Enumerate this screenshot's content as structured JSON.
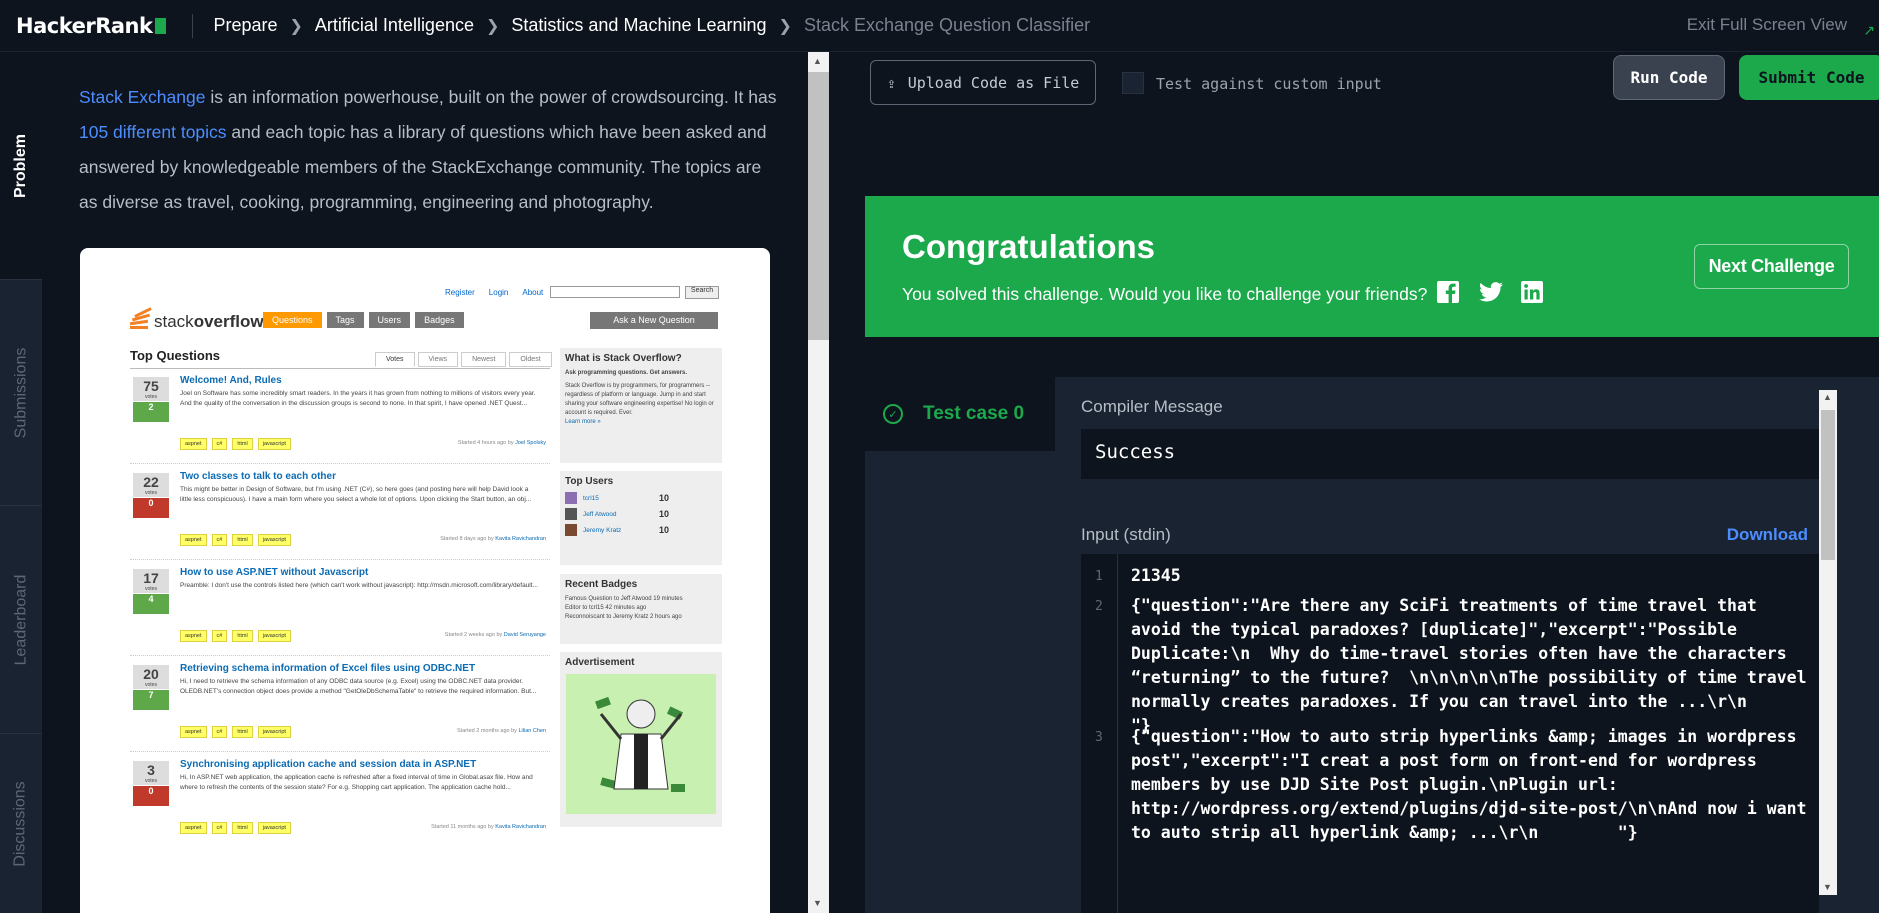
{
  "header": {
    "logo": "HackerRank",
    "breadcrumbs": [
      "Prepare",
      "Artificial Intelligence",
      "Statistics and Machine Learning"
    ],
    "current": "Stack Exchange Question Classifier",
    "exit_fullscreen": "Exit Full Screen View"
  },
  "vtabs": [
    "Problem",
    "Submissions",
    "Leaderboard",
    "Discussions"
  ],
  "problem": {
    "link1": "Stack Exchange",
    "text1": " is an information powerhouse, built on the power of crowdsourcing. It has ",
    "link2": "105 different topics",
    "text2": " and each topic has a library of questions which have been asked and answered by knowledgeable members of the StackExchange community. The topics are as diverse as travel, cooking, programming, engineering and photography."
  },
  "so_image": {
    "links": [
      "Register",
      "Login",
      "About"
    ],
    "search_btn": "Search",
    "logo_a": "stack",
    "logo_b": "overflow",
    "nav": [
      "Questions",
      "Tags",
      "Users",
      "Badges"
    ],
    "ask": "Ask a New Question",
    "title": "Top Questions",
    "tabs": [
      "Votes",
      "Views",
      "Newest",
      "Oldest"
    ],
    "questions": [
      {
        "votes": "75",
        "answers": "2",
        "status": "g",
        "title": "Welcome! And, Rules",
        "excerpt": "Joel on Software has some incredibly smart readers. In the years it has grown from nothing to millions of visitors every year. And the quality of the conversation in the discussion groups is second to none. In that spirit, I have opened .NET Quest...",
        "meta": "Started 4 hours ago by",
        "user": "Joel Spolsky"
      },
      {
        "votes": "22",
        "answers": "0",
        "status": "r",
        "title": "Two classes to talk to each other",
        "excerpt": "This might be better in Design of Software, but I'm using .NET (C#), so here goes (and posting here will help David look a little less conspicuous). I have a main form where you select a whole lot of options. Upon clicking the Start button, an obj...",
        "meta": "Started 8 days ago by",
        "user": "Kavita Ravichandran"
      },
      {
        "votes": "17",
        "answers": "4",
        "status": "g",
        "title": "How to use ASP.NET without Javascript",
        "excerpt": "Preamble: I don't use the controls listed here (which can't work without javascript): http://msdn.microsoft.com/library/default...",
        "meta": "Started 2 weeks ago by",
        "user": "David Seruyange"
      },
      {
        "votes": "20",
        "answers": "7",
        "status": "g",
        "title": "Retrieving schema information of Excel files using ODBC.NET",
        "excerpt": "Hi, I need to retrieve the schema information of any ODBC data source (e.g. Excel) using the ODBC.NET data provider. OLEDB.NET's connection object does provide a method \"GetOleDbSchemaTable\" to retrieve the required information. But...",
        "meta": "Started 2 months ago by",
        "user": "Lilian Chen"
      },
      {
        "votes": "3",
        "answers": "0",
        "status": "r",
        "title": "Synchronising application cache and session data in ASP.NET",
        "excerpt": "Hi, In ASP.NET web application, the application cache is refreshed after a fixed interval of time in Global.asax file. How and where to refresh the contents of the session state? For e.g. Shopping cart application. The application cache hold...",
        "meta": "Started 11 months ago by",
        "user": "Kavita Ravichandran"
      }
    ],
    "tags": [
      "aspnet",
      "c#",
      "html",
      "javascript"
    ],
    "votes_label": "votes",
    "answers_label": "answers",
    "sidebar": {
      "what_title": "What is Stack Overflow?",
      "what_bold": "Ask programming questions. Get answers.",
      "what_text": "Stack Overflow is by programmers, for programmers -- regardless of platform or language. Jump in and start sharing your software engineering expertise! No login or account is required. Ever.",
      "learn_more": "Learn more »",
      "top_users_title": "Top Users",
      "top_users": [
        {
          "name": "tcrl15",
          "score": "10"
        },
        {
          "name": "Jeff Atwood",
          "score": "10"
        },
        {
          "name": "Jeremy Kratz",
          "score": "10"
        }
      ],
      "badges_title": "Recent Badges",
      "badges": [
        "Famous Question to Jeff Atwood 19 minutes",
        "Editor to tcrl15 42 minutes ago",
        "Reconnoiscant to Jeremy Kratz 2 hours ago"
      ],
      "ad_title": "Advertisement"
    }
  },
  "toolbar": {
    "upload": "Upload Code as File",
    "custom_input": "Test against custom input",
    "run": "Run Code",
    "submit": "Submit Code"
  },
  "congrats": {
    "title": "Congratulations",
    "subtitle": "You solved this challenge. Would you like to challenge your friends?",
    "next": "Next Challenge"
  },
  "result": {
    "testcase": "Test case 0",
    "compiler_label": "Compiler Message",
    "compiler_value": "Success",
    "input_label": "Input (stdin)",
    "download": "Download",
    "lines": [
      {
        "n": "1",
        "text": "21345"
      },
      {
        "n": "2",
        "text": "{\"question\":\"Are there any SciFi treatments of time travel that avoid the typical paradoxes? [duplicate]\",\"excerpt\":\"Possible Duplicate:\\n  Why do time-travel stories often have the characters “returning” to the future?  \\n\\n\\n\\n\\nThe possibility of time travel normally creates paradoxes. If you can travel into the ...\\r\\n        \"}"
      },
      {
        "n": "3",
        "text": "{\"question\":\"How to auto strip hyperlinks &amp; images in wordpress post\",\"excerpt\":\"I creat a post form on front-end for wordpress members by use DJD Site Post plugin.\\nPlugin url: http://wordpress.org/extend/plugins/djd-site-post/\\n\\nAnd now i want to auto strip all hyperlink &amp; ...\\r\\n        \"}"
      }
    ]
  },
  "colors": {
    "accent": "#1ba94c",
    "link": "#4c8dff",
    "bg": "#0e141e",
    "panel": "#1a2332"
  }
}
